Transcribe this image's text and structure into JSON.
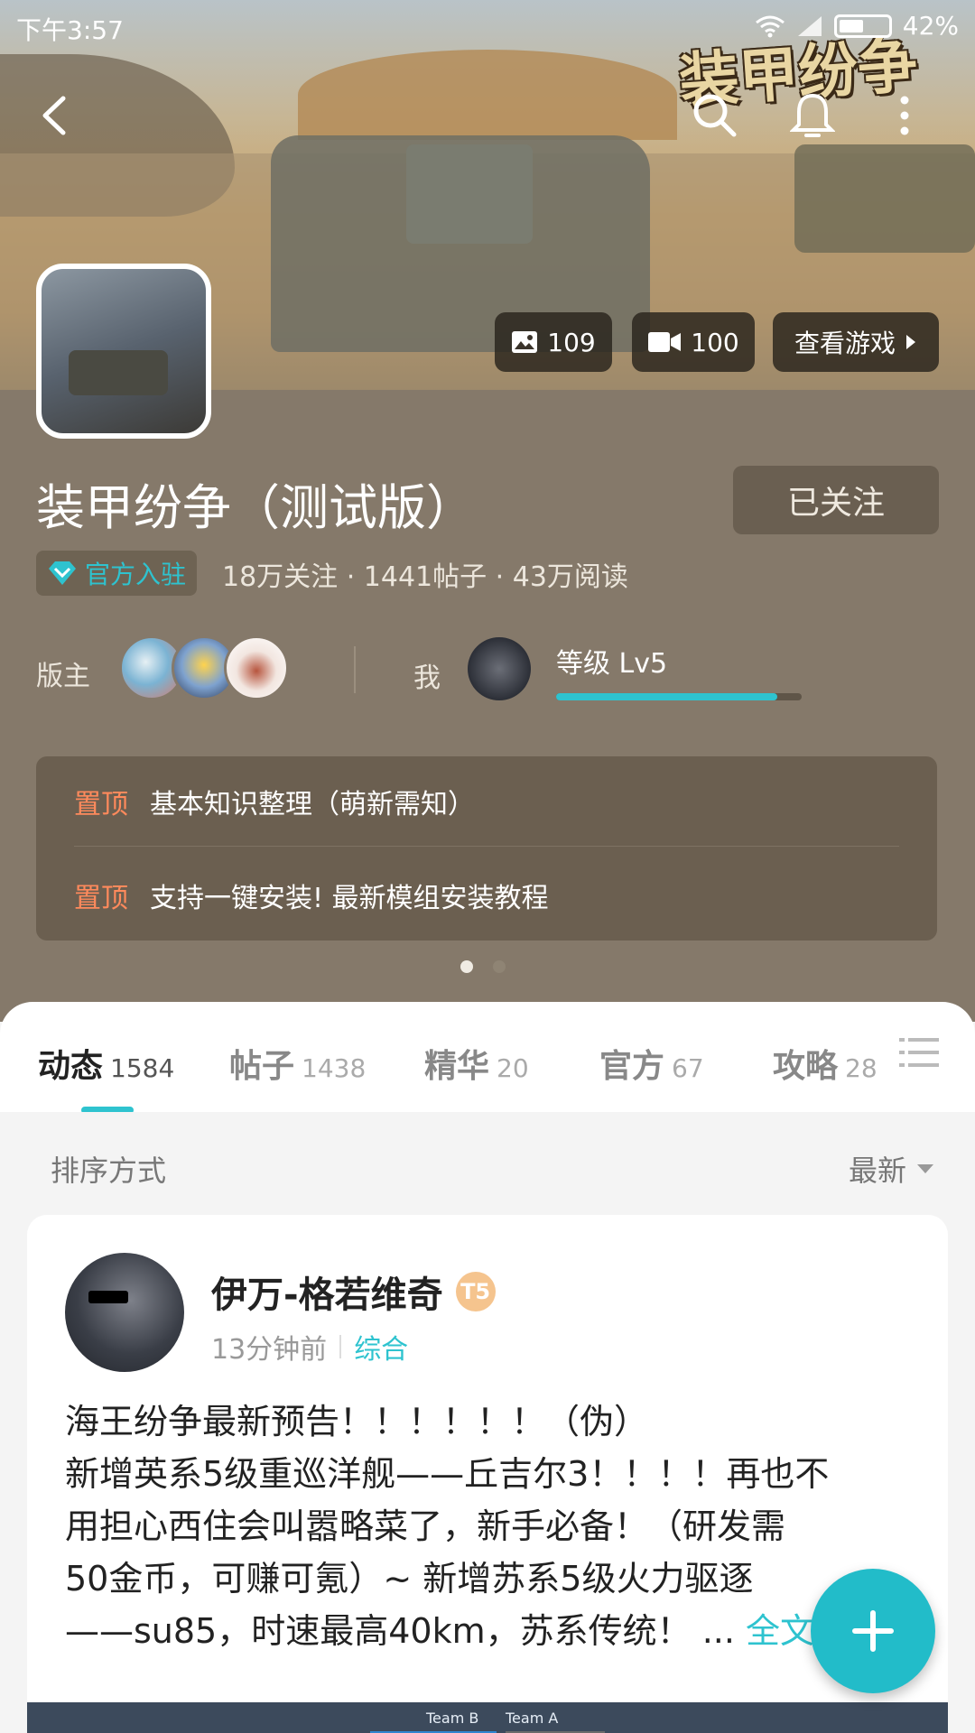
{
  "status_bar": {
    "time": "下午3:57",
    "battery": "42%"
  },
  "header": {
    "logo_text": "装甲纷争"
  },
  "game": {
    "photo_count": "109",
    "video_count": "100",
    "view_game_label": "查看游戏",
    "title": "装甲纷争（测试版）",
    "follow_label": "已关注",
    "official_label": "官方入驻",
    "stats": "18万关注 · 1441帖子 · 43万阅读"
  },
  "moderators": {
    "label": "版主"
  },
  "me": {
    "label": "我",
    "level_text": "等级 Lv5",
    "level_progress": 0.9
  },
  "pinned": [
    {
      "tag": "置顶",
      "text": "基本知识整理（萌新需知）"
    },
    {
      "tag": "置顶",
      "text": "支持一键安装! 最新模组安装教程"
    }
  ],
  "tabs": [
    {
      "label": "动态",
      "count": "1584"
    },
    {
      "label": "帖子",
      "count": "1438"
    },
    {
      "label": "精华",
      "count": "20"
    },
    {
      "label": "官方",
      "count": "67"
    },
    {
      "label": "攻略",
      "count": "28"
    }
  ],
  "sort": {
    "label": "排序方式",
    "value": "最新"
  },
  "post": {
    "author": "伊万-格若维奇",
    "badge": "T5",
    "time": "13分钟前",
    "category": "综合",
    "line1": "海王纷争最新预告！！！！！！（伪）",
    "line2": "新增英系5级重巡洋舰——丘吉尔3！！！！再也不",
    "line3": "用担心西住会叫嚣略菜了，新手必备！（研发需",
    "line4": "50金币，可赚可氪）~ 新增苏系5级火力驱逐",
    "line5": "——su85，时速最高40km，苏系传统！ ...",
    "more_label": "全文",
    "image_team_b": "Team B",
    "image_team_a": "Team A"
  },
  "colors": {
    "accent": "#2ec3cf",
    "brown_bg": "#85796a",
    "pin_tag": "#ff8a5c"
  }
}
